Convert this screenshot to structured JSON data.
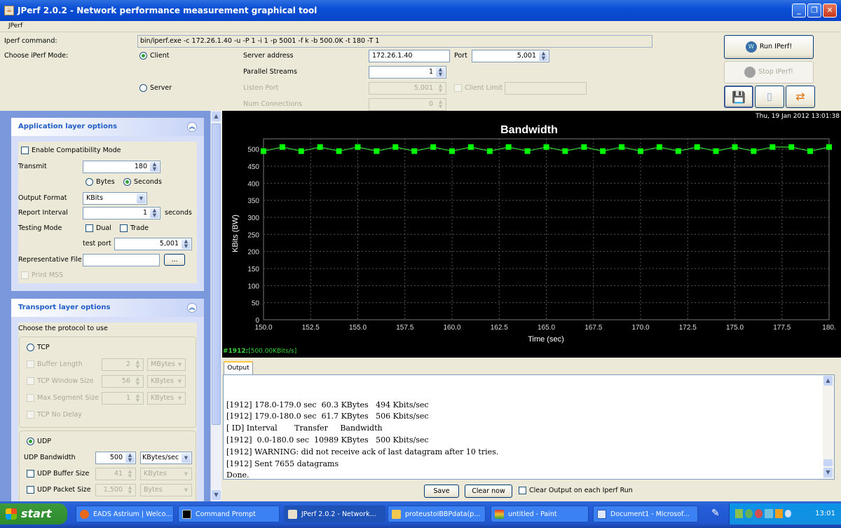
{
  "window": {
    "title": "JPerf 2.0.2 - Network performance measurement graphical tool",
    "controls": [
      "minimize",
      "restore",
      "close"
    ]
  },
  "menu": [
    "JPerf"
  ],
  "top": {
    "iperf_command_label": "Iperf command:",
    "iperf_command": "bin/iperf.exe -c 172.26.1.40 -u -P 1 -i 1 -p 5001 -f k -b 500.0K -t 180 -T 1",
    "mode_label": "Choose iPerf Mode:",
    "client_label": "Client",
    "server_label": "Server",
    "selected_mode": "Client",
    "server_address_label": "Server address",
    "server_address": "172.26.1.40",
    "port_label": "Port",
    "port": "5,001",
    "parallel_streams_label": "Parallel Streams",
    "parallel_streams": "1",
    "listen_port_label": "Listen Port",
    "listen_port": "5,001",
    "client_limit_label": "Client Limit",
    "client_limit": "",
    "num_connections_label": "Num Connections",
    "num_connections": "0",
    "run_label": "Run IPerf!",
    "stop_label": "Stop IPerf!"
  },
  "app_options": {
    "title": "Application layer options",
    "compat_label": "Enable Compatibility Mode",
    "transmit_label": "Transmit",
    "transmit": "180",
    "bytes_label": "Bytes",
    "seconds_label": "Seconds",
    "transmit_unit": "Seconds",
    "output_format_label": "Output Format",
    "output_format": "KBits",
    "report_interval_label": "Report Interval",
    "report_interval": "1",
    "report_interval_unit": "seconds",
    "testing_mode_label": "Testing Mode",
    "dual_label": "Dual",
    "trade_label": "Trade",
    "test_port_label": "test port",
    "test_port": "5,001",
    "rep_file_label": "Representative File",
    "rep_file": "",
    "browse_label": "...",
    "print_mss_label": "Print MSS"
  },
  "transport_options": {
    "title": "Transport layer options",
    "protocol_label": "Choose the protocol to use",
    "tcp_label": "TCP",
    "selected_protocol": "UDP",
    "buffer_length_label": "Buffer Length",
    "buffer_length": "2",
    "buffer_length_unit": "MBytes",
    "tcp_window_label": "TCP Window Size",
    "tcp_window": "56",
    "tcp_window_unit": "KBytes",
    "mss_label": "Max Segment Size",
    "mss": "1",
    "mss_unit": "KBytes",
    "nodelay_label": "TCP No Delay",
    "udp_label": "UDP",
    "udp_bw_label": "UDP Bandwidth",
    "udp_bw": "500",
    "udp_bw_unit": "KBytes/sec",
    "udp_buffer_label": "UDP Buffer Size",
    "udp_buffer": "41",
    "udp_buffer_unit": "KBytes",
    "udp_packet_label": "UDP Packet Size",
    "udp_packet": "1,500",
    "udp_packet_unit": "Bytes"
  },
  "chart_timestamp": "Thu, 19 Jan 2012 13:01:38",
  "chart_status": {
    "id": "#1912:",
    "value": "[500.00KBits/s]"
  },
  "chart_data": {
    "type": "line",
    "title": "Bandwidth",
    "xlabel": "Time (sec)",
    "ylabel": "KBits (BW)",
    "xlim": [
      150,
      180
    ],
    "ylim": [
      0,
      530
    ],
    "x_ticks": [
      "150.0",
      "152.5",
      "155.0",
      "157.5",
      "160.0",
      "162.5",
      "165.0",
      "167.5",
      "170.0",
      "172.5",
      "175.0",
      "177.5",
      "180."
    ],
    "y_ticks": [
      "0",
      "50",
      "100",
      "150",
      "200",
      "250",
      "300",
      "350",
      "400",
      "450",
      "500"
    ],
    "grid": true,
    "series": [
      {
        "name": "#1912",
        "color": "#00ff00",
        "x": [
          150,
          151,
          152,
          153,
          154,
          155,
          156,
          157,
          158,
          159,
          160,
          161,
          162,
          163,
          164,
          165,
          166,
          167,
          168,
          169,
          170,
          171,
          172,
          173,
          174,
          175,
          176,
          177,
          178,
          179,
          180
        ],
        "values": [
          494,
          506,
          494,
          506,
          494,
          506,
          494,
          506,
          494,
          506,
          494,
          506,
          494,
          506,
          494,
          506,
          494,
          506,
          494,
          506,
          494,
          506,
          494,
          506,
          494,
          506,
          494,
          506,
          506,
          494,
          506
        ]
      }
    ]
  },
  "output": {
    "tab_label": "Output",
    "lines": [
      "[1912] 178.0-179.0 sec  60.3 KBytes   494 Kbits/sec",
      "[1912] 179.0-180.0 sec  61.7 KBytes   506 Kbits/sec",
      "[ ID] Interval       Transfer     Bandwidth",
      "[1912]  0.0-180.0 sec  10989 KBytes   500 Kbits/sec",
      "[1912] WARNING: did not receive ack of last datagram after 10 tries.",
      "[1912] Sent 7655 datagrams",
      "Done."
    ],
    "save_label": "Save",
    "clear_label": "Clear now",
    "clear_each_label": "Clear Output on each Iperf Run"
  },
  "taskbar": {
    "start_label": "start",
    "tasks": [
      {
        "label": "EADS Astrium | Welco...",
        "icon": "firefox-icon"
      },
      {
        "label": "Command Prompt",
        "icon": "cmd-icon"
      },
      {
        "label": "JPerf 2.0.2 - Network...",
        "icon": "java-icon"
      },
      {
        "label": "proteustoIBBPdata(p...",
        "icon": "folder-icon"
      },
      {
        "label": "untitled - Paint",
        "icon": "paint-icon"
      },
      {
        "label": "Document1 - Microsof...",
        "icon": "word-icon"
      }
    ],
    "clock": "13:01"
  }
}
